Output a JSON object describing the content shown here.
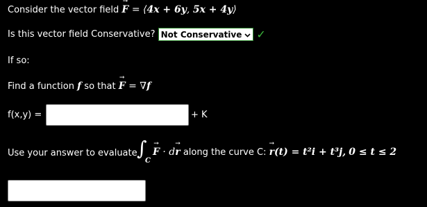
{
  "line1": {
    "prefix": "Consider the vector field",
    "field_expr": "= ⟨",
    "comp1": "4x + 6y",
    "comp2": "5x + 4y",
    "close": "⟩",
    "F": "F"
  },
  "line2": {
    "question": "Is this vector field Conservative?",
    "selected": "Not Conservative",
    "check": "✓"
  },
  "line3": {
    "text": "If so:"
  },
  "line4": {
    "prefix": "Find a function",
    "f": "f",
    "so_that": "so that",
    "F": "F",
    "eq": "= ∇",
    "f2": "f"
  },
  "line5": {
    "label": "f(x,y) =",
    "value": "",
    "plus_k": "+ K"
  },
  "line6": {
    "prefix": "Use your answer to evaluate",
    "integral": "∫",
    "sub": "C",
    "F": "F",
    "dot": "· d",
    "r": "r",
    "along": "along the curve C:",
    "r2": "r",
    "curve": "(t) = t²i + t³j,",
    "range": "0 ≤ t ≤ 2"
  },
  "answer": {
    "value": ""
  }
}
